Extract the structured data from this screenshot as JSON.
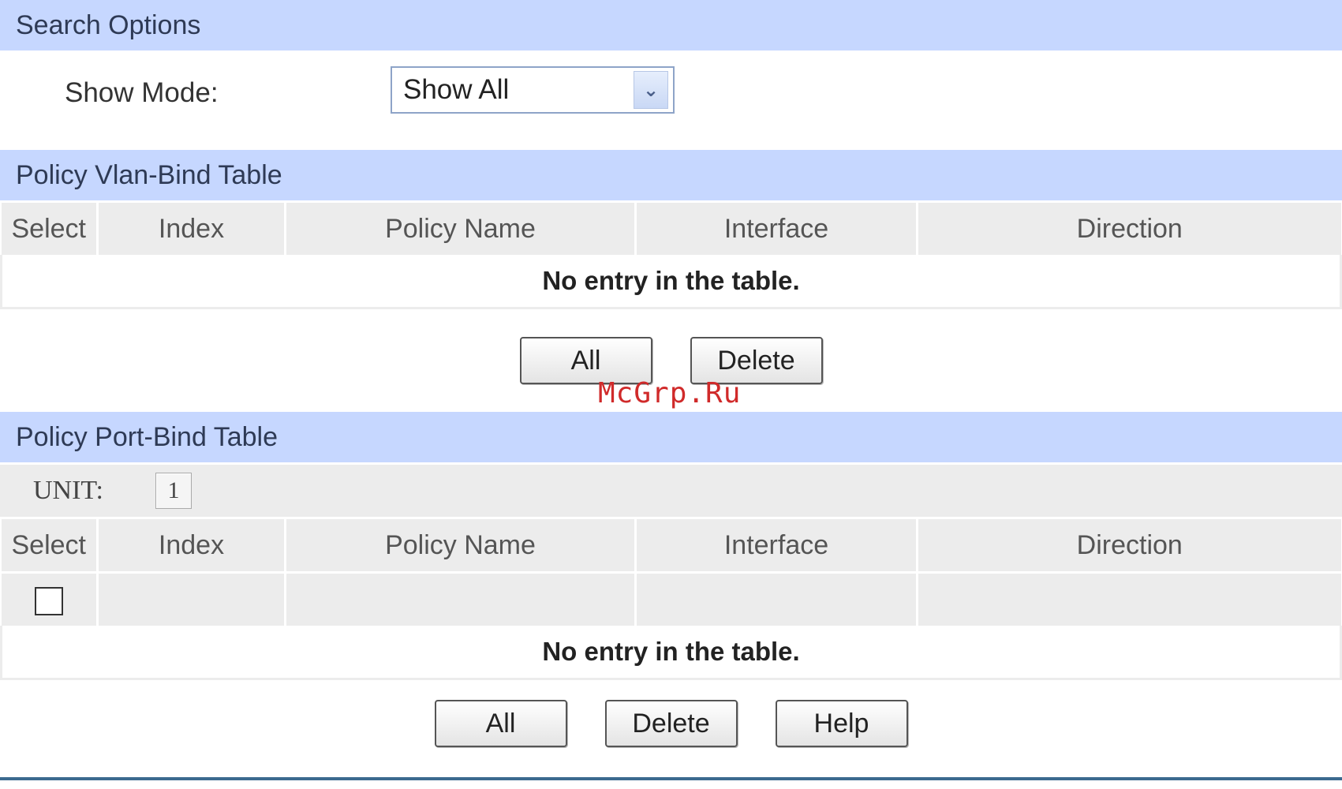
{
  "search_options": {
    "title": "Search Options",
    "show_mode_label": "Show Mode:",
    "show_mode_value": "Show All"
  },
  "vlan_table": {
    "title": "Policy Vlan-Bind Table",
    "columns": [
      "Select",
      "Index",
      "Policy Name",
      "Interface",
      "Direction"
    ],
    "empty_message": "No entry in the table.",
    "buttons": {
      "all": "All",
      "delete": "Delete"
    }
  },
  "watermark": "McGrp.Ru",
  "port_table": {
    "title": "Policy Port-Bind Table",
    "unit_label": "UNIT:",
    "unit_value": "1",
    "columns": [
      "Select",
      "Index",
      "Policy Name",
      "Interface",
      "Direction"
    ],
    "empty_message": "No entry in the table.",
    "buttons": {
      "all": "All",
      "delete": "Delete",
      "help": "Help"
    }
  },
  "colors": {
    "section_header": "#c6d7ff",
    "table_header": "#ececec",
    "watermark": "#d02a2a"
  }
}
